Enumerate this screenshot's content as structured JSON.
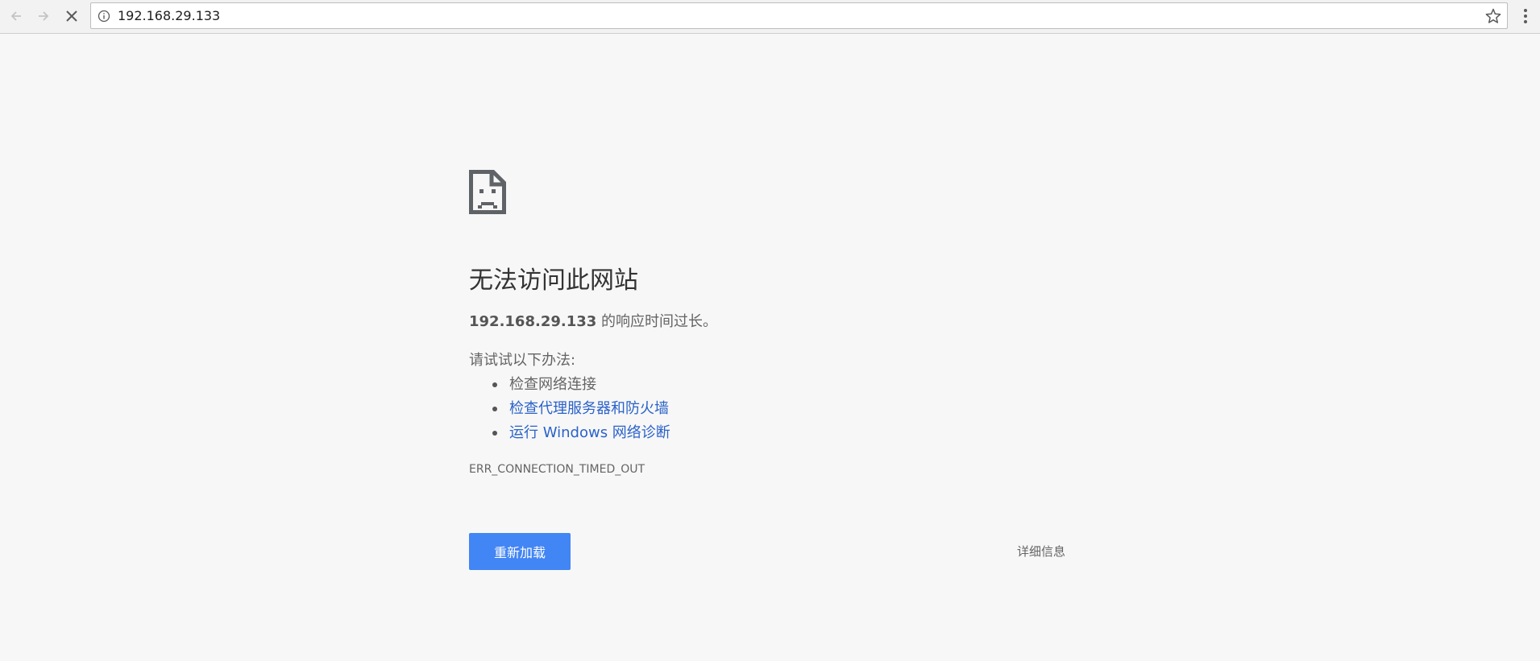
{
  "browser": {
    "url": "192.168.29.133",
    "icons": {
      "back": "arrow-left-icon",
      "forward": "arrow-right-icon",
      "stop": "close-icon",
      "info": "info-circle-icon",
      "bookmark": "star-icon",
      "menu": "more-vert-icon"
    }
  },
  "error_page": {
    "icon": "sad-document-icon",
    "heading": "无法访问此网站",
    "host": "192.168.29.133",
    "description_suffix": " 的响应时间过长。",
    "suggestions_title": "请试试以下办法:",
    "suggestions": [
      {
        "label": "检查网络连接",
        "is_link": false
      },
      {
        "label": "检查代理服务器和防火墙",
        "is_link": true
      },
      {
        "label": "运行 Windows 网络诊断",
        "is_link": true
      }
    ],
    "error_code": "ERR_CONNECTION_TIMED_OUT",
    "reload_label": "重新加载",
    "details_label": "详细信息"
  },
  "colors": {
    "background": "#f7f7f7",
    "link": "#2a62c9",
    "primary_button": "#4285f4",
    "text": "#646464",
    "heading": "#333333"
  }
}
